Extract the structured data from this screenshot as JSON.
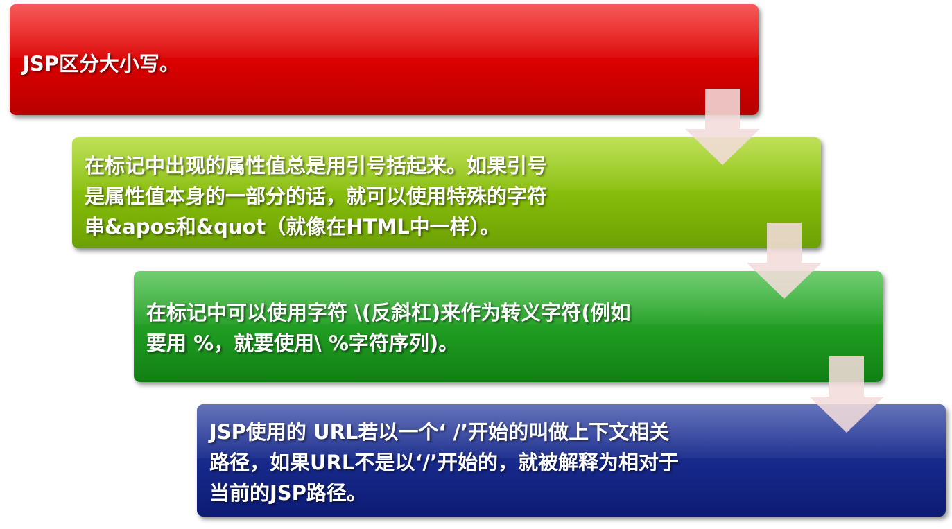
{
  "steps": [
    {
      "text": "JSP区分大小写。",
      "color": "#d90000"
    },
    {
      "text": "在标记中出现的属性值总是用引号括起来。如果引号\n是属性值本身的一部分的话，就可以使用特殊的字符\n串&apos和&quot（就像在HTML中一样）。",
      "color": "#84bb0a"
    },
    {
      "text": "在标记中可以使用字符 \\(反斜杠)来作为转义字符(例如\n要用 %，就要使用\\ %字符序列)。",
      "color": "#1f9b21"
    },
    {
      "text": "JSP使用的 URL若以一个‘ /’开始的叫做上下文相关\n路径，如果URL不是以‘/’开始的，就被解释为相对于\n当前的JSP路径。",
      "color": "#16288a"
    }
  ],
  "arrow_color": "#f2dcdb"
}
